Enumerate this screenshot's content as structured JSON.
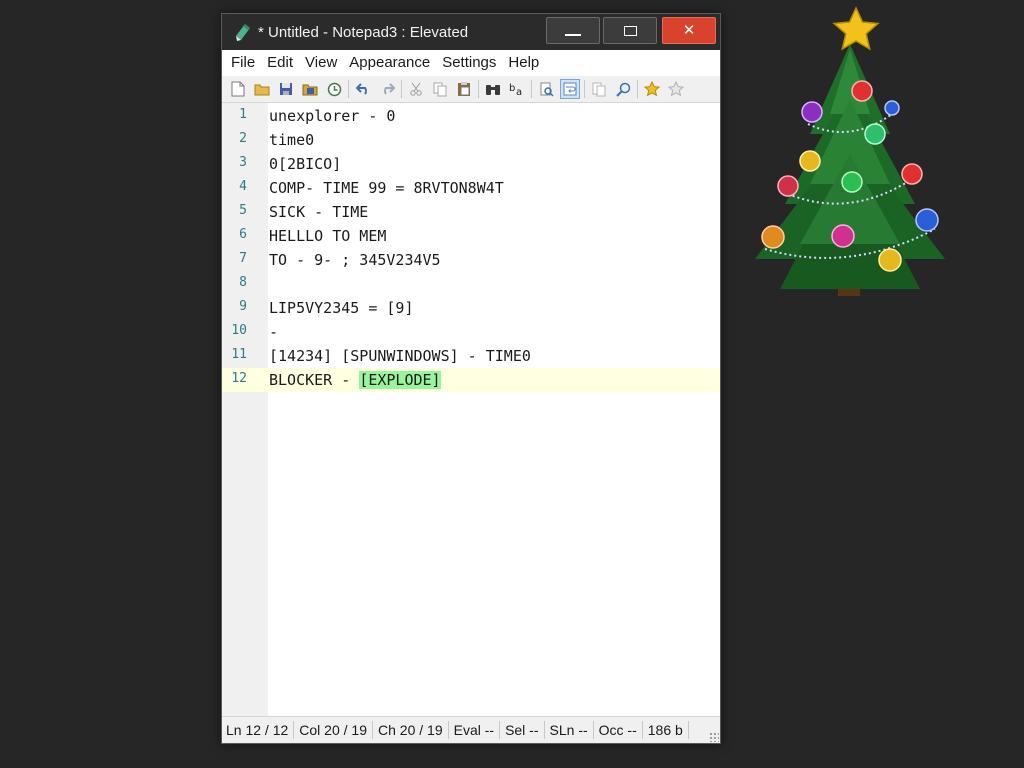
{
  "window": {
    "title": "* Untitled - Notepad3 : Elevated",
    "controls": {
      "minimize": "minimize",
      "maximize": "maximize",
      "close": "✕"
    },
    "close_color": "#d9432e"
  },
  "menu": [
    "File",
    "Edit",
    "View",
    "Appearance",
    "Settings",
    "Help"
  ],
  "toolbar": [
    "new-file-icon",
    "open-folder-icon",
    "save-icon",
    "save-as-icon",
    "revert-icon",
    "undo-icon",
    "redo-icon",
    "cut-icon",
    "copy-icon",
    "paste-icon",
    "find-icon",
    "replace-icon",
    "find-in-files-icon",
    "word-wrap-icon",
    "zoom-in-icon",
    "zoom-out-icon",
    "favorites-icon",
    "add-favorite-icon"
  ],
  "editor": {
    "current_line": 12,
    "lines": [
      {
        "n": "1",
        "text": "unexplorer - 0"
      },
      {
        "n": "2",
        "text": "time0"
      },
      {
        "n": "3",
        "text": "0[2BICO]"
      },
      {
        "n": "4",
        "text": "COMP- TIME 99 = 8RVTON8W4T"
      },
      {
        "n": "5",
        "text": "SICK - TIME"
      },
      {
        "n": "6",
        "text": "HELLLO TO MEM"
      },
      {
        "n": "7",
        "text": "TO - 9- ; 345V234V5"
      },
      {
        "n": "8",
        "text": ""
      },
      {
        "n": "9",
        "text": "LIP5VY2345 = [9]"
      },
      {
        "n": "10",
        "text": "-"
      },
      {
        "n": "11",
        "text": "[14234] [SPUNWINDOWS] - TIME0"
      },
      {
        "n": "12",
        "text": "BLOCKER - ",
        "highlight": "[EXPLODE]"
      }
    ],
    "line_number_color": "#2b7c84",
    "current_line_color": "#ffffe1",
    "brace_match_color": "#9af59a"
  },
  "status": {
    "ln": "Ln  12 / 12",
    "col": "Col  20 / 19",
    "ch": "Ch  20 / 19",
    "eval": "Eval  --",
    "sel": "Sel  --",
    "sln": "SLn  --",
    "occ": "Occ  --",
    "size": "186 b"
  },
  "desktop": {
    "background": "#262626",
    "decoration": "christmas-tree-icon"
  }
}
